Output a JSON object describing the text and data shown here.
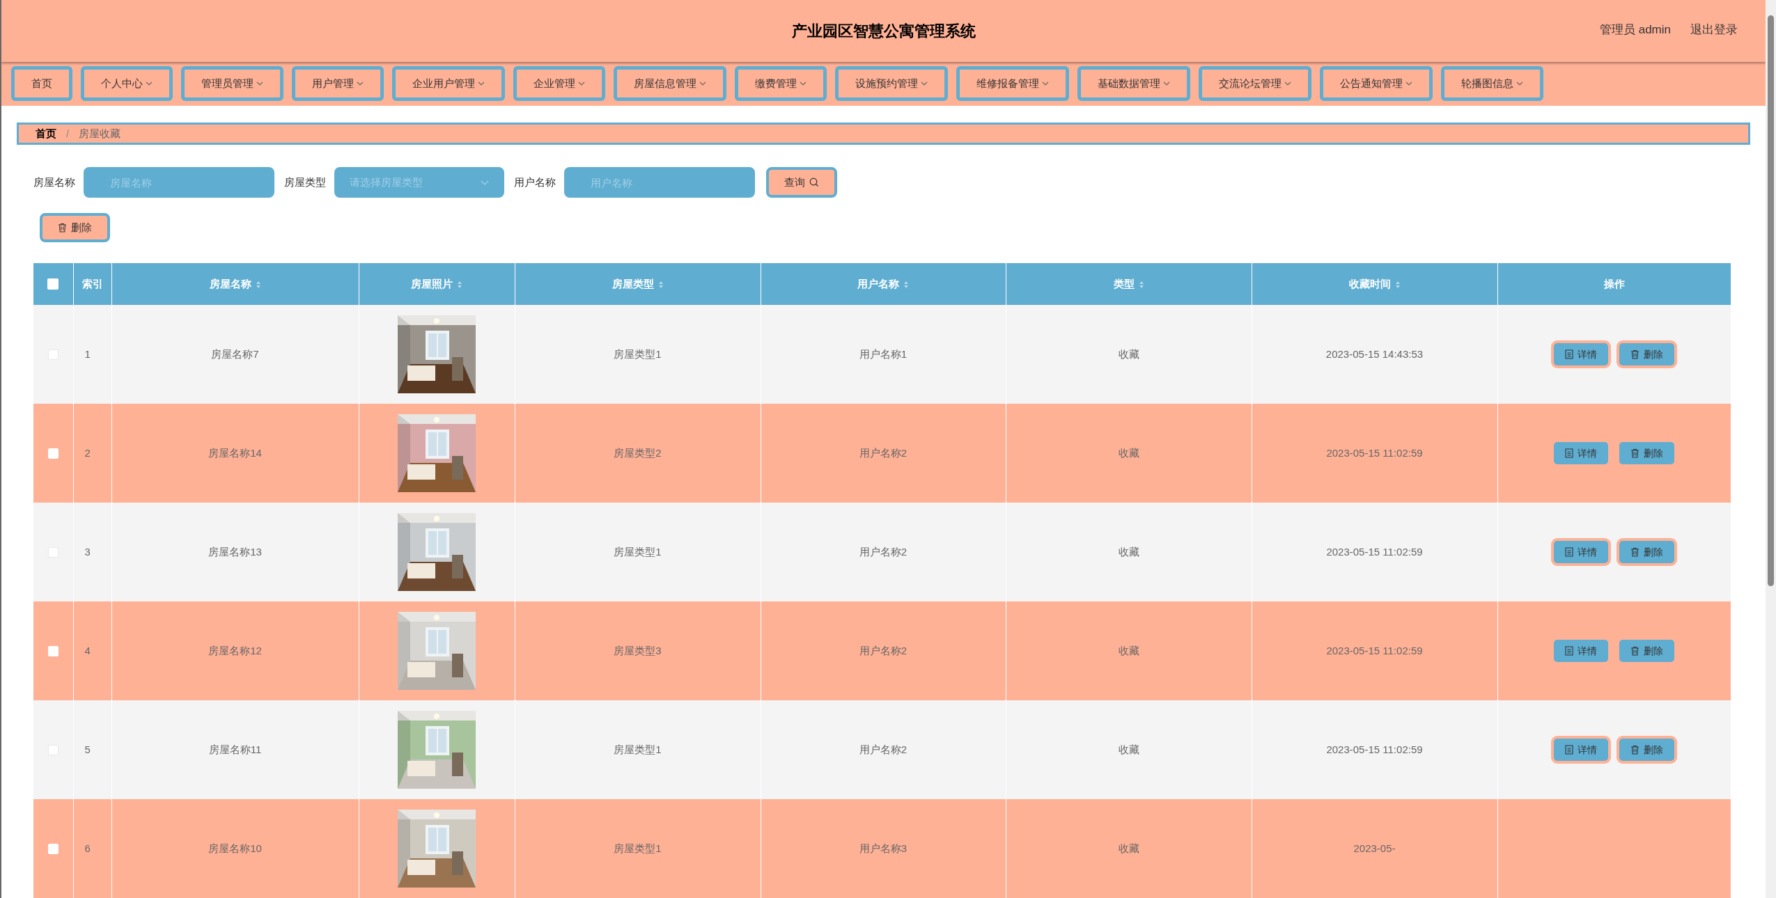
{
  "header": {
    "title": "产业园区智慧公寓管理系统",
    "user": "管理员 admin",
    "logout": "退出登录"
  },
  "nav": [
    {
      "label": "首页",
      "dropdown": false
    },
    {
      "label": "个人中心",
      "dropdown": true
    },
    {
      "label": "管理员管理",
      "dropdown": true
    },
    {
      "label": "用户管理",
      "dropdown": true
    },
    {
      "label": "企业用户管理",
      "dropdown": true
    },
    {
      "label": "企业管理",
      "dropdown": true
    },
    {
      "label": "房屋信息管理",
      "dropdown": true
    },
    {
      "label": "缴费管理",
      "dropdown": true
    },
    {
      "label": "设施预约管理",
      "dropdown": true
    },
    {
      "label": "维修报备管理",
      "dropdown": true
    },
    {
      "label": "基础数据管理",
      "dropdown": true
    },
    {
      "label": "交流论坛管理",
      "dropdown": true
    },
    {
      "label": "公告通知管理",
      "dropdown": true
    },
    {
      "label": "轮播图信息",
      "dropdown": true
    }
  ],
  "breadcrumb": [
    "首页",
    "房屋收藏"
  ],
  "breadcrumb_separator": "/",
  "filters": [
    {
      "kind": "input",
      "label": "房屋名称",
      "placeholder": "房屋名称"
    },
    {
      "kind": "select",
      "label": "房屋类型",
      "placeholder": "请选择房屋类型"
    },
    {
      "kind": "input",
      "label": "用户名称",
      "placeholder": "用户名称"
    }
  ],
  "search_button": "查询",
  "delete_button": "删除",
  "table": {
    "select_all": {
      "checked": false
    },
    "columns": [
      {
        "label": "索引",
        "sortable": false
      },
      {
        "label": "房屋名称",
        "sortable": true
      },
      {
        "label": "房屋照片",
        "sortable": true
      },
      {
        "label": "房屋类型",
        "sortable": true
      },
      {
        "label": "用户名称",
        "sortable": true
      },
      {
        "label": "类型",
        "sortable": true
      },
      {
        "label": "收藏时间",
        "sortable": true
      },
      {
        "label": "操作",
        "sortable": false
      }
    ],
    "rows": [
      {
        "checked": false,
        "index": "1",
        "name": "房屋名称7",
        "photo": {
          "kind": "picture"
        },
        "type": "房屋类型1",
        "user": "用户名称1",
        "kind": "收藏",
        "time": "2023-05-15 14:43:53",
        "actions": [
          "详情",
          "删除"
        ]
      },
      {
        "checked": false,
        "index": "2",
        "name": "房屋名称14",
        "photo": {
          "kind": "picture"
        },
        "type": "房屋类型2",
        "user": "用户名称2",
        "kind": "收藏",
        "time": "2023-05-15 11:02:59",
        "actions": [
          "详情",
          "删除"
        ]
      },
      {
        "checked": false,
        "index": "3",
        "name": "房屋名称13",
        "photo": {
          "kind": "picture"
        },
        "type": "房屋类型1",
        "user": "用户名称2",
        "kind": "收藏",
        "time": "2023-05-15 11:02:59",
        "actions": [
          "详情",
          "删除"
        ]
      },
      {
        "checked": false,
        "index": "4",
        "name": "房屋名称12",
        "photo": {
          "kind": "picture"
        },
        "type": "房屋类型3",
        "user": "用户名称2",
        "kind": "收藏",
        "time": "2023-05-15 11:02:59",
        "actions": [
          "详情",
          "删除"
        ]
      },
      {
        "checked": false,
        "index": "5",
        "name": "房屋名称11",
        "photo": {
          "kind": "picture"
        },
        "type": "房屋类型1",
        "user": "用户名称2",
        "kind": "收藏",
        "time": "2023-05-15 11:02:59",
        "actions": [
          "详情",
          "删除"
        ]
      },
      {
        "checked": false,
        "index": "6",
        "name": "房屋名称10",
        "photo": {
          "kind": "picture"
        },
        "type": "房屋类型1",
        "user": "用户名称3",
        "kind": "收藏",
        "time": "2023-05-"
      }
    ]
  }
}
